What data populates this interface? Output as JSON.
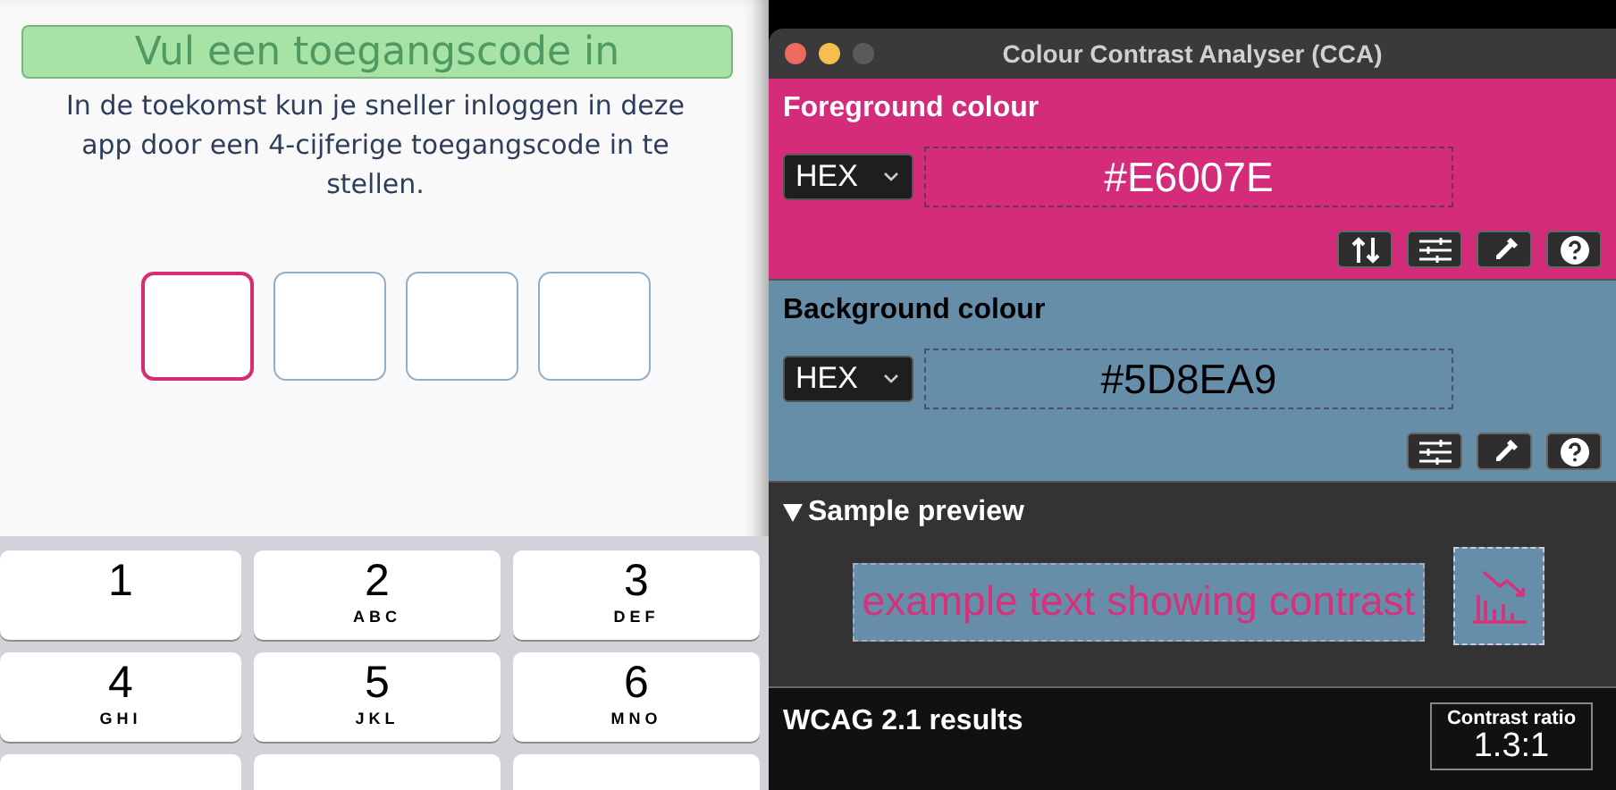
{
  "app": {
    "title": "Vul een toegangscode in",
    "description": "In de toekomst kun je sneller inloggen in deze app door een 4-cijferige toegangscode in te stellen.",
    "code_boxes": [
      {
        "selected": true
      },
      {
        "selected": false
      },
      {
        "selected": false
      },
      {
        "selected": false
      }
    ],
    "keypad": [
      {
        "kind": "digit",
        "digit": "1"
      },
      {
        "kind": "digit",
        "digit": "2",
        "letters": "ABC"
      },
      {
        "kind": "digit",
        "digit": "3",
        "letters": "DEF"
      },
      {
        "kind": "digit",
        "digit": "4",
        "letters": "GHI"
      },
      {
        "kind": "digit",
        "digit": "5",
        "letters": "JKL"
      },
      {
        "kind": "digit",
        "digit": "6",
        "letters": "MNO"
      },
      {
        "kind": "cut"
      },
      {
        "kind": "cut"
      },
      {
        "kind": "cut"
      }
    ]
  },
  "window": {
    "title": "Colour Contrast Analyser (CCA)",
    "sections": [
      {
        "kind": "foreground",
        "heading": "Foreground colour",
        "format": "HEX",
        "value": "#E6007E",
        "tools": [
          {
            "kind": "swap"
          },
          {
            "kind": "sliders"
          },
          {
            "kind": "eyedropper"
          },
          {
            "kind": "help"
          }
        ]
      },
      {
        "kind": "background",
        "heading": "Background colour",
        "format": "HEX",
        "value": "#5D8EA9",
        "tools": [
          {
            "kind": "sliders"
          },
          {
            "kind": "eyedropper"
          },
          {
            "kind": "help"
          }
        ]
      }
    ],
    "sample_preview": {
      "heading": "Sample preview",
      "expanded": true,
      "sample_text": "example text showing contrast"
    },
    "results": {
      "heading": "WCAG 2.1 results",
      "ratio_label": "Contrast ratio",
      "ratio": "1.3:1"
    }
  }
}
